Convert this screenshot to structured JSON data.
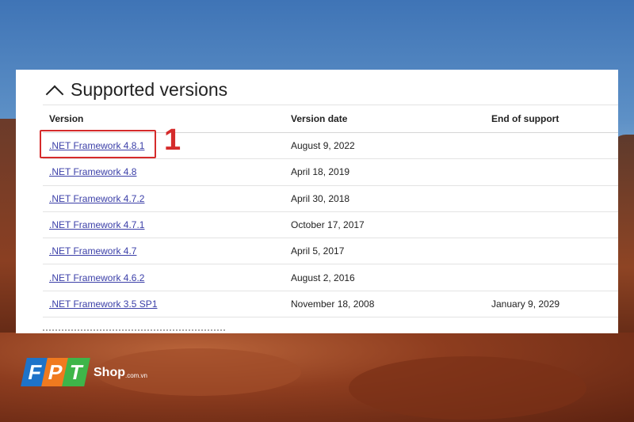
{
  "section": {
    "title": "Supported versions"
  },
  "table": {
    "headers": {
      "version": "Version",
      "date": "Version date",
      "end": "End of support"
    },
    "rows": [
      {
        "version": ".NET Framework 4.8.1",
        "date": "August 9, 2022",
        "end": ""
      },
      {
        "version": ".NET Framework 4.8",
        "date": "April 18, 2019",
        "end": ""
      },
      {
        "version": ".NET Framework 4.7.2",
        "date": "April 30, 2018",
        "end": ""
      },
      {
        "version": ".NET Framework 4.7.1",
        "date": "October 17, 2017",
        "end": ""
      },
      {
        "version": ".NET Framework 4.7",
        "date": "April 5, 2017",
        "end": ""
      },
      {
        "version": ".NET Framework 4.6.2",
        "date": "August 2, 2016",
        "end": ""
      },
      {
        "version": ".NET Framework 3.5 SP1",
        "date": "November 18, 2008",
        "end": "January 9, 2029"
      }
    ]
  },
  "annotation": {
    "step": "1",
    "color": "#d52b2b"
  },
  "logo": {
    "letters": [
      "F",
      "P",
      "T"
    ],
    "shop": "Shop",
    "domain": ".com.vn"
  },
  "icons": {
    "collapse": "chevron-up-icon"
  }
}
